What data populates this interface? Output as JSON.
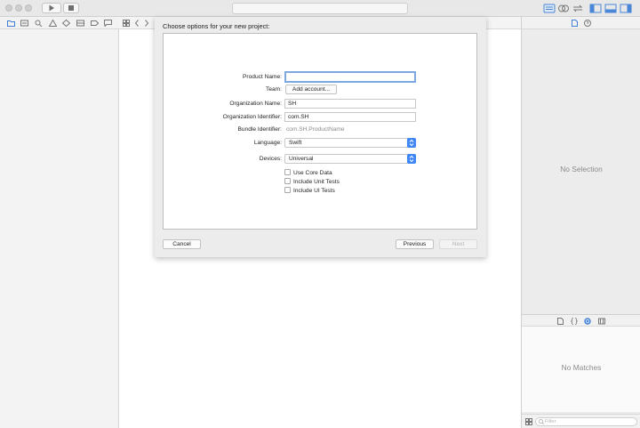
{
  "toolbar": {
    "run_icon": "play-icon",
    "stop_icon": "stop-icon",
    "right_icons": [
      "standard-editor-icon",
      "assistant-editor-icon",
      "version-editor-icon",
      "navigator-toggle-icon",
      "debug-toggle-icon",
      "utilities-toggle-icon"
    ]
  },
  "navigator": {
    "icons": [
      "folder-icon",
      "symbol-icon",
      "search-icon",
      "issue-icon",
      "test-icon",
      "debug-icon",
      "breakpoint-icon",
      "report-icon"
    ]
  },
  "sheet": {
    "title": "Choose options for your new project:",
    "fields": {
      "product_name": {
        "label": "Product Name:",
        "value": ""
      },
      "team": {
        "label": "Team:",
        "button": "Add account..."
      },
      "org_name": {
        "label": "Organization Name:",
        "value": "SH"
      },
      "org_identifier": {
        "label": "Organization Identifier:",
        "value": "com.SH"
      },
      "bundle_identifier": {
        "label": "Bundle Identifier:",
        "value": "com.SH.ProductName"
      },
      "language": {
        "label": "Language:",
        "value": "Swift"
      },
      "devices": {
        "label": "Devices:",
        "value": "Universal"
      }
    },
    "checkboxes": [
      {
        "label": "Use Core Data",
        "checked": false
      },
      {
        "label": "Include Unit Tests",
        "checked": false
      },
      {
        "label": "Include UI Tests",
        "checked": false
      }
    ],
    "buttons": {
      "cancel": "Cancel",
      "previous": "Previous",
      "next": "Next"
    }
  },
  "inspector": {
    "no_selection": "No Selection",
    "no_matches": "No Matches",
    "filter_placeholder": "Filter"
  },
  "colors": {
    "accent": "#3f86f7",
    "focus_ring": "#7ea8e0"
  }
}
